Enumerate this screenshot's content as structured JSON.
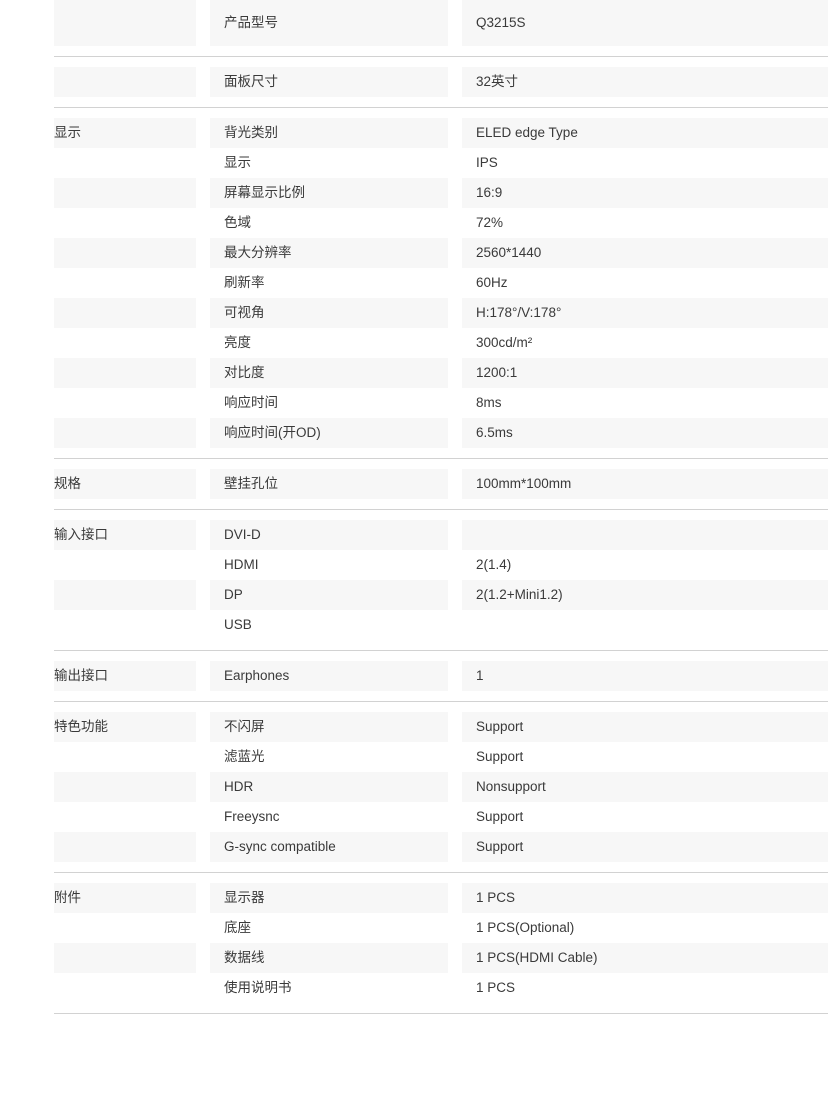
{
  "page": {
    "title": "Product Specifications Table",
    "accent_color": "#f7f7f7",
    "rule_color": "#d2d2d2",
    "text_color": "#3a3a3a"
  },
  "sections": [
    {
      "group": "",
      "rows": [
        {
          "group": "",
          "item": "产品型号",
          "value": "Q3215S"
        }
      ]
    },
    {
      "group": "",
      "rows": [
        {
          "group": "",
          "item": "面板尺寸",
          "value": "32英寸"
        }
      ]
    },
    {
      "group": "显示",
      "rows": [
        {
          "group": "显示",
          "item": "背光类别",
          "value": "ELED edge Type"
        },
        {
          "group": "",
          "item": "显示",
          "value": "IPS"
        },
        {
          "group": "",
          "item": "屏幕显示比例",
          "value": "16:9"
        },
        {
          "group": "",
          "item": "色域",
          "value": "72%"
        },
        {
          "group": "",
          "item": "最大分辨率",
          "value": "2560*1440"
        },
        {
          "group": "",
          "item": "刷新率",
          "value": "60Hz"
        },
        {
          "group": "",
          "item": "可视角",
          "value": "H:178°/V:178°"
        },
        {
          "group": "",
          "item": "亮度",
          "value": "300cd/m²"
        },
        {
          "group": "",
          "item": "对比度",
          "value": "1200:1"
        },
        {
          "group": "",
          "item": "响应时间",
          "value": "8ms"
        },
        {
          "group": "",
          "item": "响应时间(开OD)",
          "value": "6.5ms"
        }
      ]
    },
    {
      "group": "规格",
      "rows": [
        {
          "group": "规格",
          "item": "壁挂孔位",
          "value": "100mm*100mm"
        }
      ]
    },
    {
      "group": "输入接口",
      "rows": [
        {
          "group": "输入接口",
          "item": "DVI-D",
          "value": ""
        },
        {
          "group": "",
          "item": "HDMI",
          "value": "2(1.4)"
        },
        {
          "group": "",
          "item": "DP",
          "value": "2(1.2+Mini1.2)"
        },
        {
          "group": "",
          "item": "USB",
          "value": ""
        }
      ]
    },
    {
      "group": "输出接口",
      "rows": [
        {
          "group": "输出接口",
          "item": "Earphones",
          "value": "1"
        }
      ]
    },
    {
      "group": "特色功能",
      "rows": [
        {
          "group": "特色功能",
          "item": "不闪屏",
          "value": "Support"
        },
        {
          "group": "",
          "item": "滤蓝光",
          "value": "Support"
        },
        {
          "group": "",
          "item": "HDR",
          "value": "Nonsupport"
        },
        {
          "group": "",
          "item": "Freeysnc",
          "value": "Support"
        },
        {
          "group": "",
          "item": "G-sync compatible",
          "value": "Support"
        }
      ]
    },
    {
      "group": "附件",
      "rows": [
        {
          "group": "附件",
          "item": "显示器",
          "value": "1 PCS"
        },
        {
          "group": "",
          "item": "底座",
          "value": "1 PCS(Optional)"
        },
        {
          "group": "",
          "item": "数据线",
          "value": "1 PCS(HDMI Cable)"
        },
        {
          "group": "",
          "item": "使用说明书",
          "value": "1 PCS"
        }
      ]
    }
  ]
}
